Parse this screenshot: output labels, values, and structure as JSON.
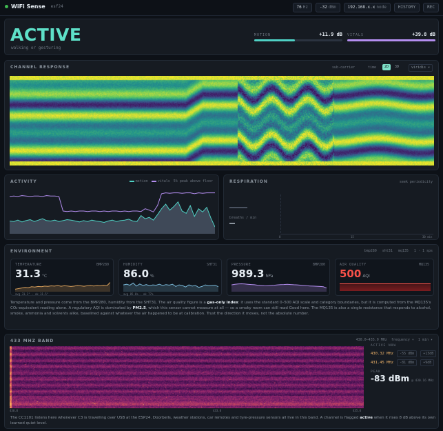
{
  "topbar": {
    "title": "WiFi Sense",
    "version": "esf24",
    "stats": [
      {
        "value": "76",
        "unit": "Hz"
      },
      {
        "value": "-32",
        "unit": "dBm"
      },
      {
        "value": "192.168.x.x",
        "unit": "node"
      }
    ],
    "history_label": "HISTORY",
    "rec_label": "REC",
    "status_color": "#3fb950"
  },
  "hero": {
    "state": "ACTIVE",
    "subtitle": "walking or gesturing",
    "motion": {
      "label": "MOTION",
      "value": "+11.9 dB",
      "fill": 0.46,
      "color": "#4fd1c5"
    },
    "vitals": {
      "label": "VITALS",
      "value": "+39.8 dB",
      "fill": 1.0,
      "color": "#b48ef0"
    }
  },
  "channel": {
    "title": "CHANNEL RESPONSE",
    "sub_label": "sub-carrier",
    "time_label": "time",
    "mode_2d": "2D",
    "mode_3d": "3D",
    "colormap": "viridis"
  },
  "activity": {
    "title": "ACTIVITY",
    "legend_motion": "motion",
    "legend_vitals": "vitals",
    "legend_note": "5% peak above floor",
    "motion_color": "#4fd1c5",
    "vitals_color": "#b48ef0",
    "motion_series": [
      0.28,
      0.27,
      0.3,
      0.26,
      0.29,
      0.31,
      0.27,
      0.3,
      0.33,
      0.29,
      0.28,
      0.3,
      0.27,
      0.29,
      0.31,
      0.3,
      0.28,
      0.26,
      0.29,
      0.27,
      0.3,
      0.28,
      0.27,
      0.25,
      0.28,
      0.3,
      0.27,
      0.29,
      0.3,
      0.32,
      0.28,
      0.27,
      0.4,
      0.33,
      0.36,
      0.3,
      0.42,
      0.55,
      0.65,
      0.52,
      0.6,
      0.7,
      0.5,
      0.45,
      0.62,
      0.38,
      0.55,
      0.48,
      0.58,
      0.35,
      0.15
    ],
    "vitals_series": [
      0.82,
      0.83,
      0.82,
      0.84,
      0.83,
      0.82,
      0.83,
      0.83,
      0.82,
      0.84,
      0.83,
      0.83,
      0.82,
      0.5,
      0.49,
      0.5,
      0.49,
      0.5,
      0.5,
      0.49,
      0.5,
      0.5,
      0.49,
      0.5,
      0.49,
      0.5,
      0.5,
      0.49,
      0.5,
      0.49,
      0.5,
      0.5,
      0.49,
      0.55,
      0.52,
      0.48,
      0.62,
      0.88,
      0.9,
      0.89,
      0.9,
      0.9,
      0.89,
      0.9,
      0.9,
      0.88,
      0.9,
      0.89,
      0.9,
      0.9,
      0.9
    ]
  },
  "respiration": {
    "title": "RESPIRATION",
    "right_label": "seek periodicity",
    "metric_label": "breaths / min",
    "ticks": [
      "0",
      "15",
      "30 min"
    ]
  },
  "environment": {
    "title": "ENVIRONMENT",
    "right_tabs": [
      "bmp280",
      "sht31",
      "mq135",
      "1 · 1 sps"
    ],
    "cards": [
      {
        "label": "TEMPERATURE",
        "right": "BMP280",
        "value": "31.3",
        "unit": "°C",
        "stats": "avg 31.2°  ·  ok 31.5°",
        "color": "#d9a05b",
        "series": [
          0.2,
          0.25,
          0.3,
          0.35,
          0.32,
          0.4,
          0.38,
          0.42,
          0.4,
          0.45,
          0.43,
          0.47,
          0.45,
          0.5,
          0.44,
          0.48,
          0.46,
          0.42,
          0.45,
          0.5,
          0.47,
          0.44,
          0.48,
          0.5,
          0.46,
          0.5,
          0.47,
          0.52,
          0.49,
          0.75
        ]
      },
      {
        "label": "HUMIDITY",
        "right": "SHT31",
        "value": "86.0",
        "unit": "%",
        "stats": "avg 85.6%  ·  ok 77%",
        "color": "#79b8d8",
        "series": [
          0.55,
          0.6,
          0.52,
          0.7,
          0.45,
          0.62,
          0.5,
          0.58,
          0.48,
          0.55,
          0.52,
          0.6,
          0.5,
          0.57,
          0.53,
          0.6,
          0.42,
          0.55,
          0.5,
          0.38,
          0.55,
          0.45,
          0.5,
          0.35,
          0.42,
          0.55,
          0.48,
          0.5,
          0.52,
          0.4
        ]
      },
      {
        "label": "PRESSURE",
        "right": "BMP280",
        "value": "989.3",
        "unit": "hPa",
        "stats": "",
        "color": "#b48ef0",
        "series": [
          0.55,
          0.6,
          0.62,
          0.64,
          0.63,
          0.6,
          0.58,
          0.56,
          0.52,
          0.5,
          0.48,
          0.47,
          0.5,
          0.52,
          0.55,
          0.57,
          0.58,
          0.6,
          0.58,
          0.56,
          0.55,
          0.53,
          0.5,
          0.48,
          0.46,
          0.45,
          0.44,
          0.42,
          0.4,
          0.3
        ]
      },
      {
        "label": "AIR QUALITY",
        "right": "MQ135",
        "value": "500",
        "unit": "AQI",
        "stats": "",
        "color": "#f85149",
        "series": [
          0.5,
          0.5,
          0.5,
          0.5,
          0.5,
          0.5,
          0.5,
          0.5,
          0.5,
          0.5,
          0.5,
          0.5,
          0.5,
          0.5,
          0.5,
          0.5,
          0.5,
          0.5,
          0.5,
          0.5
        ]
      }
    ],
    "note_a": "Temperature and pressure come from the BMP280, humidity from the SHT31. The air quality figure is a ",
    "note_b": "gas-only index",
    "note_c": ": it uses the standard 0–500 AQI scale and category boundaries, but it is computed from the MQ135's CO₂-equivalent reading alone. A regulatory AQI is dominated by ",
    "note_d": "PM2.5",
    "note_e": ", which this sensor cannot measure at all — so a smoky room can still read Good here. The MQ135 is also a single resistance that responds to alcohol, smoke, ammonia and solvents alike, baselined against whatever the air happened to be at calibration. Trust the direction it moves, not the absolute number."
  },
  "band": {
    "title": "433 MHZ BAND",
    "range_label": "430.0–435.0 MHz",
    "mode_label": "frequency",
    "time_label": "1 min",
    "axis_left": "430.0",
    "axis_mid": "433.8",
    "axis_right": "435.0",
    "active_label": "ACTIVE NOW",
    "signals": [
      {
        "freq": "430.32 MHz",
        "power": "-55 dBm",
        "delta": "+13dB"
      },
      {
        "freq": "431.45 MHz",
        "power": "-81 dBm",
        "delta": "+9dB"
      }
    ],
    "peak_label": "PEAK",
    "peak_value": "-83 dBm",
    "peak_freq": "@ 430.16 MHz",
    "note_a": "The CC1101 listens here whenever C3 is travelling over USB at the ESP24. Doorbells, weather stations, car remotes and tyre-pressure sensors all live in this band. A channel is flagged ",
    "note_b": "active",
    "note_c": " when it rises 8 dB above its own learned quiet level."
  }
}
